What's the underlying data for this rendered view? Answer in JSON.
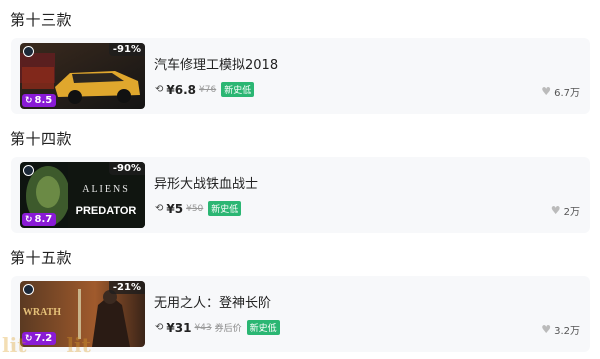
{
  "sections": [
    {
      "title": "第十三款",
      "game": {
        "name": "汽车修理工模拟2018",
        "discount": "-91%",
        "score": "8.5",
        "price_icon": "price-tag-icon",
        "price_now": "¥6.8",
        "price_old": "¥76",
        "coupon": "",
        "low_label": "新史低",
        "likes": "6.7万"
      }
    },
    {
      "title": "第十四款",
      "game": {
        "name": "异形大战铁血战士",
        "discount": "-90%",
        "score": "8.7",
        "price_icon": "price-tag-icon",
        "price_now": "¥5",
        "price_old": "¥50",
        "coupon": "",
        "low_label": "新史低",
        "likes": "2万"
      }
    },
    {
      "title": "第十五款",
      "game": {
        "name": "无用之人：登神长阶",
        "discount": "-21%",
        "score": "7.2",
        "price_icon": "price-tag-icon",
        "price_now": "¥31",
        "price_old": "¥43",
        "coupon": "券后价",
        "low_label": "新史低",
        "likes": "3.2万"
      }
    }
  ],
  "thumb_text": {
    "aliens_line1": "ALIENS",
    "aliens_line2": "PREDATOR",
    "wrath_title": "WRATH"
  },
  "watermark": [
    "lit",
    "lit"
  ]
}
